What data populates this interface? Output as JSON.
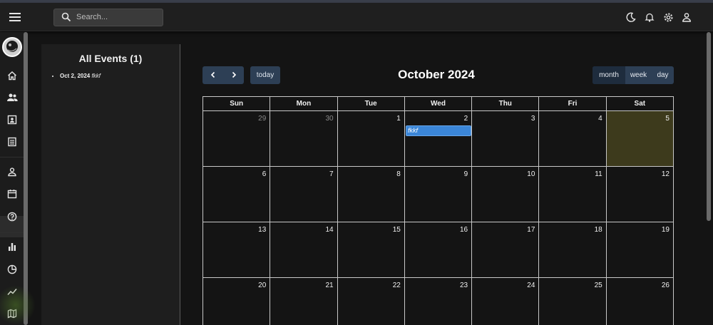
{
  "appbar": {
    "search_placeholder": "Search...",
    "icons": [
      "menu-icon",
      "search-icon",
      "moon-icon",
      "bell-icon",
      "gear-icon",
      "user-icon"
    ]
  },
  "sidenav": {
    "icons": [
      "home-icon",
      "users-icon",
      "contact-card-icon",
      "list-icon",
      "person-icon",
      "calendar-icon",
      "help-icon",
      "bar-chart-icon",
      "pie-chart-icon",
      "line-chart-icon",
      "map-icon"
    ],
    "active": "calendar-icon"
  },
  "events_panel": {
    "title": "All Events (1)",
    "items": [
      {
        "date": "Oct 2, 2024",
        "name": "fkkf"
      }
    ]
  },
  "calendar": {
    "title": "October 2024",
    "today_label": "today",
    "views": [
      "month",
      "week",
      "day"
    ],
    "active_view": "month",
    "weekdays": [
      "Sun",
      "Mon",
      "Tue",
      "Wed",
      "Thu",
      "Fri",
      "Sat"
    ],
    "weeks": [
      [
        "29",
        "30",
        "1",
        "2",
        "3",
        "4",
        "5"
      ],
      [
        "6",
        "7",
        "8",
        "9",
        "10",
        "11",
        "12"
      ],
      [
        "13",
        "14",
        "15",
        "16",
        "17",
        "18",
        "19"
      ],
      [
        "20",
        "21",
        "22",
        "23",
        "24",
        "25",
        "26"
      ]
    ],
    "event": {
      "title": "fkkf",
      "date_label": "2"
    },
    "colors": {
      "event": "#3b86d8",
      "today_highlight": "#3d3a1c",
      "button": "#2d3f55"
    }
  }
}
